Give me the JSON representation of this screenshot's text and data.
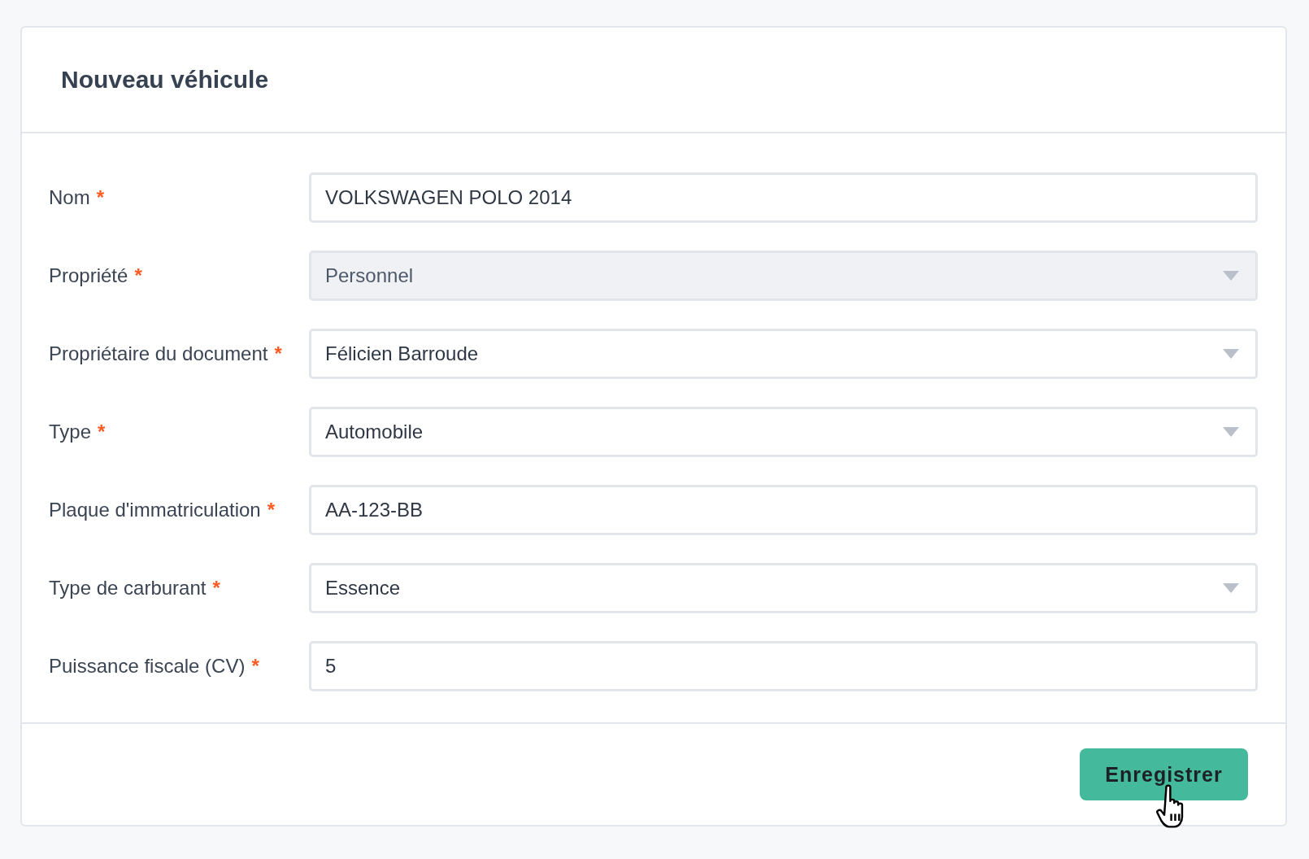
{
  "form": {
    "title": "Nouveau véhicule",
    "fields": [
      {
        "label": "Nom",
        "required_mark": "*",
        "kind": "text",
        "value": "VOLKSWAGEN POLO 2014",
        "disabled": false
      },
      {
        "label": "Propriété",
        "required_mark": "*",
        "kind": "select",
        "value": "Personnel",
        "disabled": true
      },
      {
        "label": "Propriétaire du document",
        "required_mark": "*",
        "kind": "select",
        "value": "Félicien Barroude",
        "disabled": false
      },
      {
        "label": "Type",
        "required_mark": "*",
        "kind": "select",
        "value": "Automobile",
        "disabled": false
      },
      {
        "label": "Plaque d'immatriculation",
        "required_mark": "*",
        "kind": "text",
        "value": "AA-123-BB",
        "disabled": false
      },
      {
        "label": "Type de carburant",
        "required_mark": "*",
        "kind": "select",
        "value": "Essence",
        "disabled": false
      },
      {
        "label": "Puissance fiscale (CV)",
        "required_mark": "*",
        "kind": "text",
        "value": "5",
        "disabled": false
      }
    ],
    "submit_button": "Enregistrer"
  }
}
